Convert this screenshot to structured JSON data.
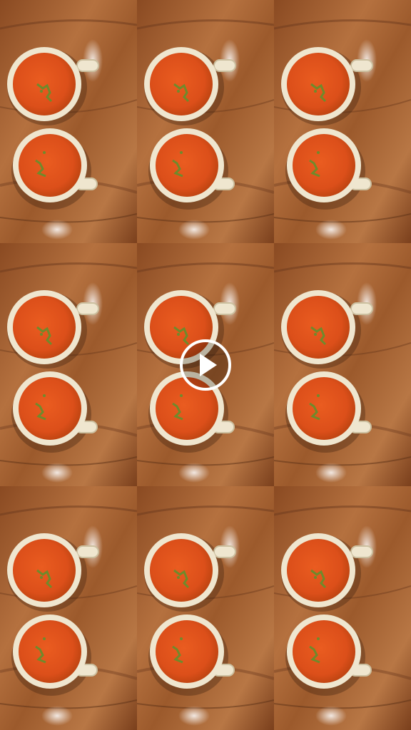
{
  "video": {
    "state": "paused",
    "content": "soup-cups-tiled",
    "grid": {
      "rows": 3,
      "cols": 3
    }
  },
  "controls": {
    "play_icon": "play-icon"
  },
  "colors": {
    "wood_light": "#b5713f",
    "wood_dark": "#6b3a1d",
    "soup": "#e0511c",
    "soup_dark": "#c2410f",
    "cup": "#efe6cf",
    "herb": "#6f8a2b"
  }
}
